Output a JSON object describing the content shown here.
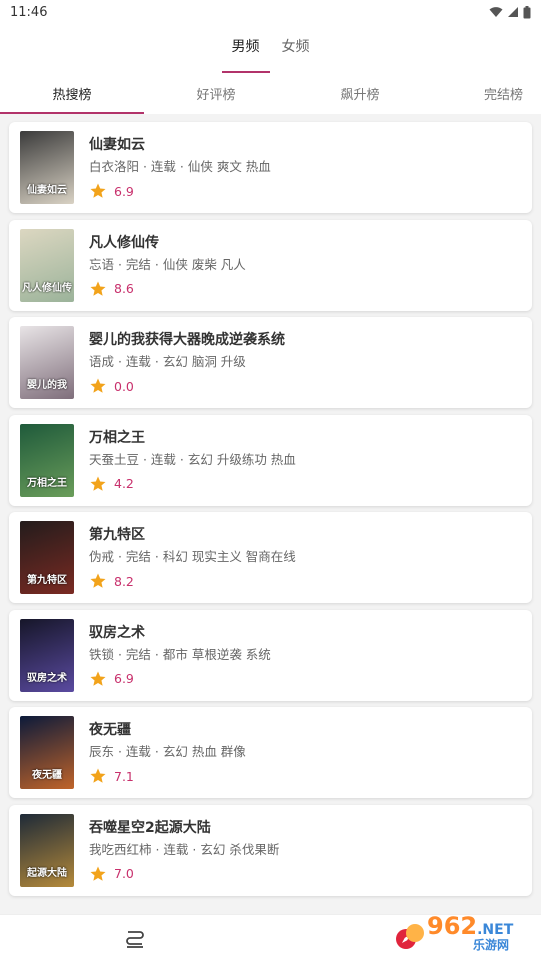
{
  "status": {
    "time": "11:46"
  },
  "top_tabs": [
    {
      "label": "男频",
      "active": true
    },
    {
      "label": "女频",
      "active": false
    }
  ],
  "rank_tabs": [
    {
      "label": "热搜榜",
      "active": true
    },
    {
      "label": "好评榜",
      "active": false
    },
    {
      "label": "飙升榜",
      "active": false
    },
    {
      "label": "完结榜",
      "active": false
    }
  ],
  "books": [
    {
      "title": "仙妻如云",
      "meta": "白衣洛阳 · 连载 · 仙侠 爽文 热血",
      "score": "6.9",
      "cover_text": "仙妻如云",
      "cover_colors": [
        "#3b3b3b",
        "#d9d2c4"
      ]
    },
    {
      "title": "凡人修仙传",
      "meta": "忘语 · 完结 · 仙侠 废柴 凡人",
      "score": "8.6",
      "cover_text": "凡人修仙传",
      "cover_colors": [
        "#dcd7c1",
        "#9bb39a"
      ]
    },
    {
      "title": "婴儿的我获得大器晚成逆袭系统",
      "meta": "语成 · 连载 · 玄幻 脑洞 升级",
      "score": "0.0",
      "cover_text": "婴儿的我",
      "cover_colors": [
        "#e8e4e6",
        "#7f6e7b"
      ]
    },
    {
      "title": "万相之王",
      "meta": "天蚕土豆 · 连载 · 玄幻 升级练功 热血",
      "score": "4.2",
      "cover_text": "万相之王",
      "cover_colors": [
        "#1f5a3b",
        "#6a9d5a"
      ]
    },
    {
      "title": "第九特区",
      "meta": "伪戒 · 完结 · 科幻 现实主义 智商在线",
      "score": "8.2",
      "cover_text": "第九特区",
      "cover_colors": [
        "#231c1c",
        "#7a2a22"
      ]
    },
    {
      "title": "驭房之术",
      "meta": "铁锁 · 完结 · 都市 草根逆袭 系统",
      "score": "6.9",
      "cover_text": "驭房之术",
      "cover_colors": [
        "#161629",
        "#5a4aa0"
      ]
    },
    {
      "title": "夜无疆",
      "meta": "辰东 · 连载 · 玄幻 热血 群像",
      "score": "7.1",
      "cover_text": "夜无疆",
      "cover_colors": [
        "#0c1a3a",
        "#c0642a"
      ]
    },
    {
      "title": "吞噬星空2起源大陆",
      "meta": "我吃西红柿 · 连载 · 玄幻 杀伐果断",
      "score": "7.0",
      "cover_text": "起源大陆",
      "cover_colors": [
        "#1e2a38",
        "#b58a3a"
      ]
    }
  ],
  "nav": [
    {
      "icon": "bookshelf-icon"
    },
    {
      "icon": "compass-icon"
    }
  ],
  "watermark": {
    "num": "962",
    "net": ".NET",
    "sub": "乐游网"
  }
}
